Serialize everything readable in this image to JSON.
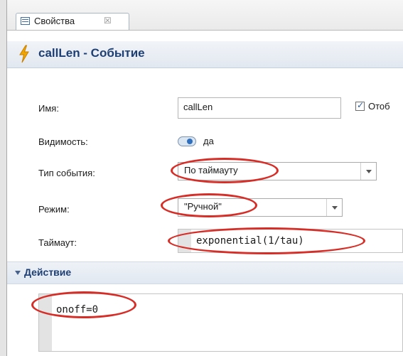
{
  "tab": {
    "label": "Свойства",
    "close": "☒"
  },
  "header": {
    "title": "callLen - Событие"
  },
  "form": {
    "name": {
      "label": "Имя:",
      "value": "callLen",
      "show_checkbox_label": "Отоб"
    },
    "visibility": {
      "label": "Видимость:",
      "value": "да"
    },
    "event_type": {
      "label": "Тип события:",
      "value": "По таймауту"
    },
    "mode": {
      "label": "Режим:",
      "value": "\"Ручной\""
    },
    "timeout": {
      "label": "Таймаут:",
      "value": "exponential(1/tau)"
    }
  },
  "action": {
    "title": "Действие",
    "code": "onoff=0"
  },
  "icons": {
    "tab": "properties-icon",
    "header": "lightning-bolt-icon"
  },
  "colors": {
    "accent": "#1d3f73",
    "highlight": "#d72d27",
    "bolt": "#f0a500"
  }
}
